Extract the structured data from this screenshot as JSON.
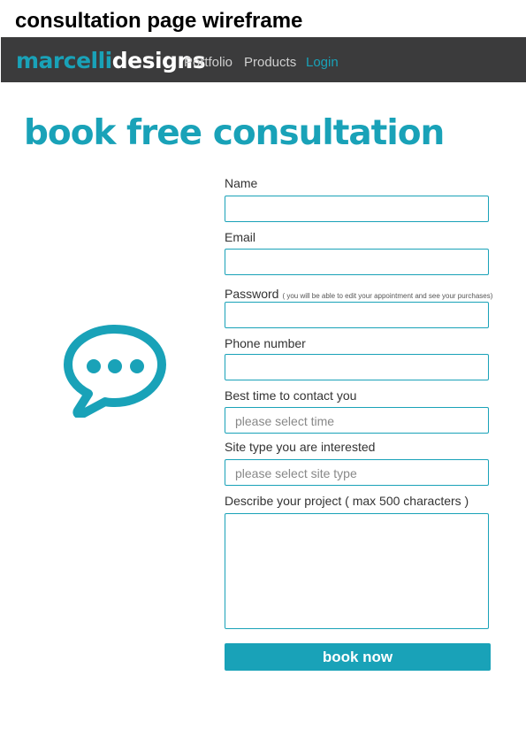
{
  "caption": "consultation page wireframe",
  "navbar": {
    "brand_part1": "marcelli",
    "brand_part2": "designs",
    "links": [
      "Portfolio",
      "Products",
      "Login"
    ]
  },
  "page_title": "book free consultation",
  "form": {
    "name_label": "Name",
    "email_label": "Email",
    "password_label": "Password",
    "password_note": "( you will be able to edit your appointment and see your purchases)",
    "phone_label": "Phone number",
    "best_time_label": "Best time to contact you",
    "best_time_placeholder": "please select time",
    "site_type_label": "Site type you are interested",
    "site_type_placeholder": "please select site type",
    "describe_label": "Describe your project ( max 500 characters )",
    "submit_label": "book now"
  },
  "colors": {
    "accent": "#19a2b8",
    "navbar_bg": "#3b3b3c"
  },
  "icons": {
    "chat": "chat-bubble-icon"
  }
}
